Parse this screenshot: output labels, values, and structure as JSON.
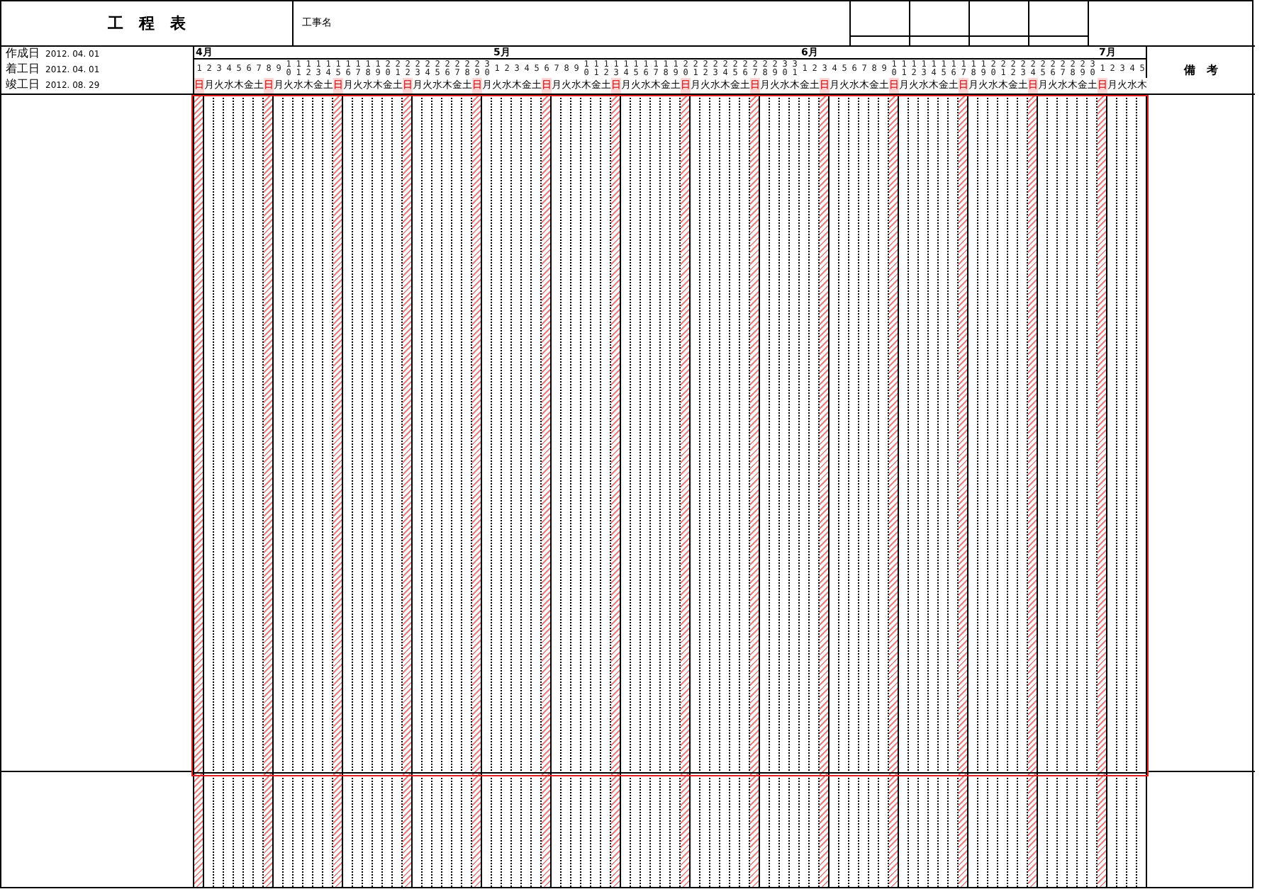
{
  "title": "工　程　表",
  "project_name_label": "工事名",
  "dates": [
    {
      "label": "作成日",
      "value": "2012. 04. 01"
    },
    {
      "label": "着工日",
      "value": "2012. 04. 01"
    },
    {
      "label": "竣工日",
      "value": "2012. 08. 29"
    }
  ],
  "remarks_label": "備　考",
  "months": [
    {
      "label": "4月",
      "days": [
        {
          "date": "1",
          "weekday": "日",
          "holiday": true
        },
        {
          "date": "2",
          "weekday": "月",
          "holiday": false
        },
        {
          "date": "3",
          "weekday": "火",
          "holiday": false
        },
        {
          "date": "4",
          "weekday": "水",
          "holiday": false
        },
        {
          "date": "5",
          "weekday": "木",
          "holiday": false
        },
        {
          "date": "6",
          "weekday": "金",
          "holiday": false
        },
        {
          "date": "7",
          "weekday": "土",
          "holiday": false
        },
        {
          "date": "8",
          "weekday": "日",
          "holiday": true
        },
        {
          "date": "9",
          "weekday": "月",
          "holiday": false
        },
        {
          "date": "10",
          "weekday": "火",
          "holiday": false
        },
        {
          "date": "11",
          "weekday": "水",
          "holiday": false
        },
        {
          "date": "12",
          "weekday": "木",
          "holiday": false
        },
        {
          "date": "13",
          "weekday": "金",
          "holiday": false
        },
        {
          "date": "14",
          "weekday": "土",
          "holiday": false
        },
        {
          "date": "15",
          "weekday": "日",
          "holiday": true
        },
        {
          "date": "16",
          "weekday": "月",
          "holiday": false
        },
        {
          "date": "17",
          "weekday": "火",
          "holiday": false
        },
        {
          "date": "18",
          "weekday": "水",
          "holiday": false
        },
        {
          "date": "19",
          "weekday": "木",
          "holiday": false
        },
        {
          "date": "20",
          "weekday": "金",
          "holiday": false
        },
        {
          "date": "21",
          "weekday": "土",
          "holiday": false
        },
        {
          "date": "22",
          "weekday": "日",
          "holiday": true
        },
        {
          "date": "23",
          "weekday": "月",
          "holiday": false
        },
        {
          "date": "24",
          "weekday": "火",
          "holiday": false
        },
        {
          "date": "25",
          "weekday": "水",
          "holiday": false
        },
        {
          "date": "26",
          "weekday": "木",
          "holiday": false
        },
        {
          "date": "27",
          "weekday": "金",
          "holiday": false
        },
        {
          "date": "28",
          "weekday": "土",
          "holiday": false
        },
        {
          "date": "29",
          "weekday": "日",
          "holiday": true
        },
        {
          "date": "30",
          "weekday": "月",
          "holiday": false
        }
      ]
    },
    {
      "label": "5月",
      "days": [
        {
          "date": "1",
          "weekday": "火",
          "holiday": false
        },
        {
          "date": "2",
          "weekday": "水",
          "holiday": false
        },
        {
          "date": "3",
          "weekday": "木",
          "holiday": false
        },
        {
          "date": "4",
          "weekday": "金",
          "holiday": false
        },
        {
          "date": "5",
          "weekday": "土",
          "holiday": false
        },
        {
          "date": "6",
          "weekday": "日",
          "holiday": true
        },
        {
          "date": "7",
          "weekday": "月",
          "holiday": false
        },
        {
          "date": "8",
          "weekday": "火",
          "holiday": false
        },
        {
          "date": "9",
          "weekday": "水",
          "holiday": false
        },
        {
          "date": "10",
          "weekday": "木",
          "holiday": false
        },
        {
          "date": "11",
          "weekday": "金",
          "holiday": false
        },
        {
          "date": "12",
          "weekday": "土",
          "holiday": false
        },
        {
          "date": "13",
          "weekday": "日",
          "holiday": true
        },
        {
          "date": "14",
          "weekday": "月",
          "holiday": false
        },
        {
          "date": "15",
          "weekday": "火",
          "holiday": false
        },
        {
          "date": "16",
          "weekday": "水",
          "holiday": false
        },
        {
          "date": "17",
          "weekday": "木",
          "holiday": false
        },
        {
          "date": "18",
          "weekday": "金",
          "holiday": false
        },
        {
          "date": "19",
          "weekday": "土",
          "holiday": false
        },
        {
          "date": "20",
          "weekday": "日",
          "holiday": true
        },
        {
          "date": "21",
          "weekday": "月",
          "holiday": false
        },
        {
          "date": "22",
          "weekday": "火",
          "holiday": false
        },
        {
          "date": "23",
          "weekday": "水",
          "holiday": false
        },
        {
          "date": "24",
          "weekday": "木",
          "holiday": false
        },
        {
          "date": "25",
          "weekday": "金",
          "holiday": false
        },
        {
          "date": "26",
          "weekday": "土",
          "holiday": false
        },
        {
          "date": "27",
          "weekday": "日",
          "holiday": true
        },
        {
          "date": "28",
          "weekday": "月",
          "holiday": false
        },
        {
          "date": "29",
          "weekday": "火",
          "holiday": false
        },
        {
          "date": "30",
          "weekday": "水",
          "holiday": false
        },
        {
          "date": "31",
          "weekday": "木",
          "holiday": false
        }
      ]
    },
    {
      "label": "6月",
      "days": [
        {
          "date": "1",
          "weekday": "金",
          "holiday": false
        },
        {
          "date": "2",
          "weekday": "土",
          "holiday": false
        },
        {
          "date": "3",
          "weekday": "日",
          "holiday": true
        },
        {
          "date": "4",
          "weekday": "月",
          "holiday": false
        },
        {
          "date": "5",
          "weekday": "火",
          "holiday": false
        },
        {
          "date": "6",
          "weekday": "水",
          "holiday": false
        },
        {
          "date": "7",
          "weekday": "木",
          "holiday": false
        },
        {
          "date": "8",
          "weekday": "金",
          "holiday": false
        },
        {
          "date": "9",
          "weekday": "土",
          "holiday": false
        },
        {
          "date": "10",
          "weekday": "日",
          "holiday": true
        },
        {
          "date": "11",
          "weekday": "月",
          "holiday": false
        },
        {
          "date": "12",
          "weekday": "火",
          "holiday": false
        },
        {
          "date": "13",
          "weekday": "水",
          "holiday": false
        },
        {
          "date": "14",
          "weekday": "木",
          "holiday": false
        },
        {
          "date": "15",
          "weekday": "金",
          "holiday": false
        },
        {
          "date": "16",
          "weekday": "土",
          "holiday": false
        },
        {
          "date": "17",
          "weekday": "日",
          "holiday": true
        },
        {
          "date": "18",
          "weekday": "月",
          "holiday": false
        },
        {
          "date": "19",
          "weekday": "火",
          "holiday": false
        },
        {
          "date": "20",
          "weekday": "水",
          "holiday": false
        },
        {
          "date": "21",
          "weekday": "木",
          "holiday": false
        },
        {
          "date": "22",
          "weekday": "金",
          "holiday": false
        },
        {
          "date": "23",
          "weekday": "土",
          "holiday": false
        },
        {
          "date": "24",
          "weekday": "日",
          "holiday": true
        },
        {
          "date": "25",
          "weekday": "月",
          "holiday": false
        },
        {
          "date": "26",
          "weekday": "火",
          "holiday": false
        },
        {
          "date": "27",
          "weekday": "水",
          "holiday": false
        },
        {
          "date": "28",
          "weekday": "木",
          "holiday": false
        },
        {
          "date": "29",
          "weekday": "金",
          "holiday": false
        },
        {
          "date": "30",
          "weekday": "土",
          "holiday": false
        }
      ]
    },
    {
      "label": "7月",
      "days": [
        {
          "date": "1",
          "weekday": "日",
          "holiday": true
        },
        {
          "date": "2",
          "weekday": "月",
          "holiday": false
        },
        {
          "date": "3",
          "weekday": "火",
          "holiday": false
        },
        {
          "date": "4",
          "weekday": "水",
          "holiday": false
        },
        {
          "date": "5",
          "weekday": "木",
          "holiday": false
        }
      ]
    }
  ]
}
